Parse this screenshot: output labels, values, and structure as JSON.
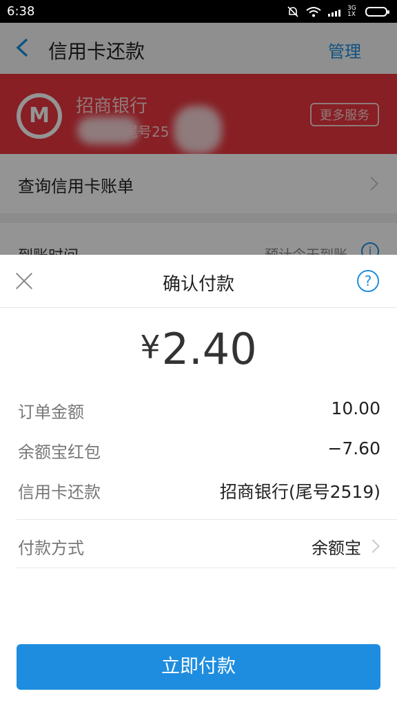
{
  "status_bar": {
    "time": "6:38",
    "network": "3G 1X"
  },
  "header": {
    "title": "信用卡还款",
    "manage": "管理"
  },
  "bank": {
    "name": "招商银行",
    "tail": "尾号25",
    "more_services": "更多服务"
  },
  "query_bill": "查询信用卡账单",
  "arrival": {
    "label": "到账时间",
    "value": "预计今天到账"
  },
  "sheet": {
    "title": "确认付款",
    "currency": "¥",
    "amount": "2.40",
    "rows": [
      {
        "label": "订单金额",
        "value": "10.00"
      },
      {
        "label": "余额宝红包",
        "value": "−7.60"
      },
      {
        "label": "信用卡还款",
        "value": "招商银行(尾号2519)"
      }
    ],
    "payment_method": {
      "label": "付款方式",
      "value": "余额宝"
    },
    "pay_button": "立即付款"
  },
  "colors": {
    "accent": "#1e8ddf",
    "bank_red": "#e8363f"
  }
}
